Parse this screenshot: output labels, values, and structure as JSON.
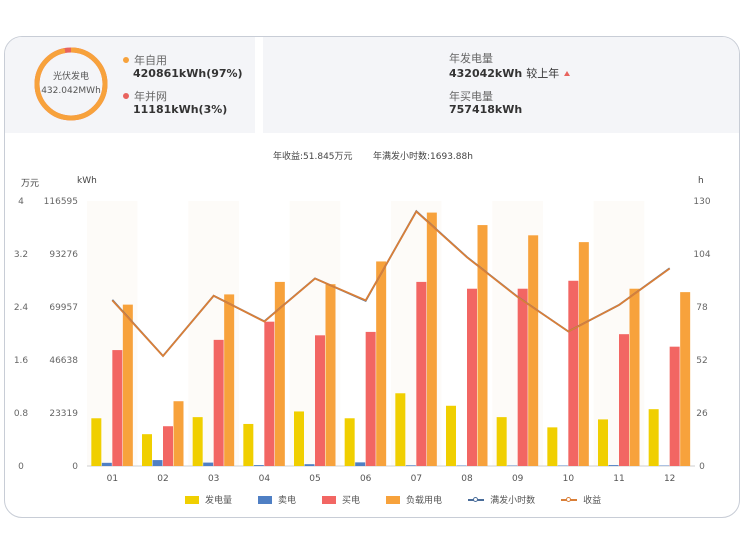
{
  "summary_left": {
    "ring_label": "光伏发电",
    "ring_value": "432.042MWh",
    "self_use_label": "年自用",
    "self_use_value": "420861kWh(97%)",
    "grid_label": "年并网",
    "grid_value": "11181kWh(3%)",
    "self_use_fraction": 0.97,
    "colors": {
      "self_use": "#f7a23c",
      "grid": "#e8635e"
    }
  },
  "summary_right": {
    "gen_label": "年发电量",
    "gen_value": "432042kWh",
    "gen_compare": "较上年",
    "buy_label": "年买电量",
    "buy_value": "757418kWh"
  },
  "chart_header": {
    "income": "年收益:51.845万元",
    "full_hours": "年满发小时数:1693.88h"
  },
  "chart_data": {
    "type": "bar",
    "categories": [
      "01",
      "02",
      "03",
      "04",
      "05",
      "06",
      "07",
      "08",
      "09",
      "10",
      "11",
      "12"
    ],
    "axes": {
      "left_unit": "万元",
      "mid_unit": "kWh",
      "right_unit": "h",
      "left_ticks": [
        "4",
        "3.2",
        "2.4",
        "1.6",
        "0.8",
        "0"
      ],
      "mid_ticks": [
        "116595",
        "93276",
        "69957",
        "46638",
        "23319",
        "0"
      ],
      "right_ticks": [
        "130",
        "104",
        "78",
        "52",
        "26",
        "0"
      ],
      "left_range": [
        0,
        4
      ],
      "mid_range": [
        0,
        116595
      ],
      "right_range": [
        0,
        130
      ]
    },
    "series": [
      {
        "name": "发电量",
        "kind": "bar",
        "axis": "mid",
        "color": "#f0cf00",
        "values": [
          21000,
          14000,
          21500,
          18500,
          24000,
          21000,
          32000,
          26500,
          21500,
          17000,
          20500,
          25000
        ]
      },
      {
        "name": "卖电",
        "kind": "bar",
        "axis": "mid",
        "color": "#4f7fc4",
        "values": [
          1400,
          2600,
          1500,
          400,
          800,
          1600,
          300,
          200,
          200,
          200,
          400,
          200
        ]
      },
      {
        "name": "买电",
        "kind": "bar",
        "axis": "mid",
        "color": "#f26663",
        "values": [
          51000,
          17500,
          55500,
          63500,
          57500,
          59000,
          81000,
          78000,
          78000,
          81500,
          58000,
          52500
        ]
      },
      {
        "name": "负载用电",
        "kind": "bar",
        "axis": "mid",
        "color": "#f7a23c",
        "values": [
          71000,
          28500,
          75500,
          81000,
          80000,
          90000,
          111500,
          106000,
          101500,
          98500,
          78000,
          76500
        ]
      },
      {
        "name": "满发小时数",
        "kind": "line",
        "axis": "right",
        "color": "#4a6d9a",
        "values": [
          81.5,
          54,
          83.5,
          71,
          92,
          81,
          125,
          102.5,
          83,
          66,
          79,
          97
        ]
      },
      {
        "name": "收益",
        "kind": "line",
        "axis": "left",
        "color": "#d97f38",
        "values": [
          2.5,
          1.66,
          2.57,
          2.18,
          2.83,
          2.5,
          3.84,
          3.15,
          2.55,
          2.03,
          2.43,
          2.98
        ]
      }
    ],
    "grid": false,
    "legend_position": "bottom"
  }
}
